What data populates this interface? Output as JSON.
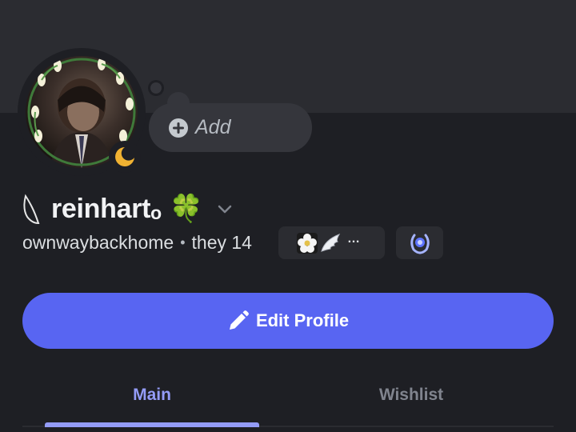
{
  "profile": {
    "display_name": "reinhartₒ",
    "name_emoji": "🍀",
    "username": "ownwaybackhome",
    "separator": "•",
    "pronouns": "they 14",
    "status_add_label": "Add",
    "badges_more": "…"
  },
  "actions": {
    "edit_profile_label": "Edit Profile"
  },
  "tabs": [
    {
      "label": "Main",
      "selected": true
    },
    {
      "label": "Wishlist",
      "selected": false
    }
  ],
  "colors": {
    "background": "#1e1f24",
    "banner": "#2b2c31",
    "accent": "#5865f2",
    "tab_active": "#949cf7",
    "tab_inactive": "#80848e",
    "status_idle": "#f0b232"
  },
  "icons": {
    "status": "moon-icon",
    "add": "plus-circle-icon",
    "name_decoration": "leaf-icon",
    "chevron": "chevron-down-icon",
    "edit": "pencil-icon",
    "badge_flower": "flower-icon",
    "badge_wing": "wing-icon",
    "badge_laurel": "laurel-icon"
  }
}
